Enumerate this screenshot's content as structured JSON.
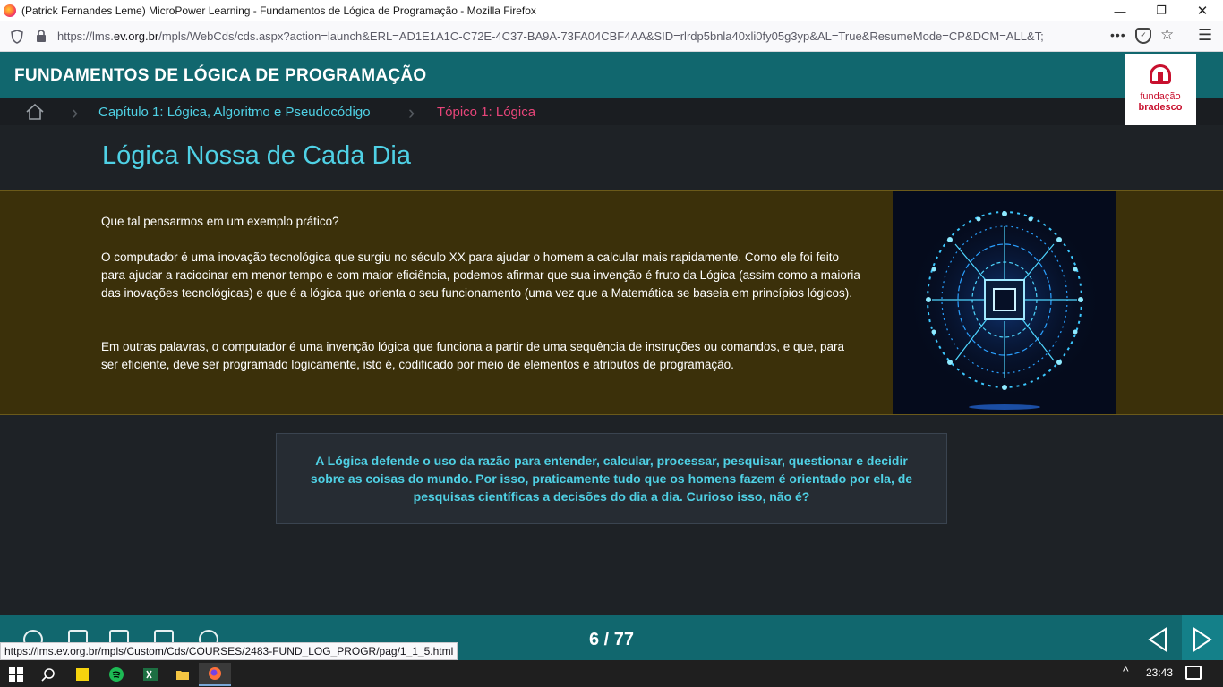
{
  "window": {
    "title": "(Patrick Fernandes Leme) MicroPower Learning - Fundamentos de Lógica de Programação - Mozilla Firefox",
    "minimize": "—",
    "restore": "❐",
    "close": "✕"
  },
  "browser": {
    "url_prefix": "https://lms.",
    "url_domain": "ev.org.br",
    "url_rest": "/mpls/WebCds/cds.aspx?action=launch&ERL=AD1E1A1C-C72E-4C37-BA9A-73FA04CBF4AA&SID=rlrdp5bnla40xli0fy05g3yp&AL=True&ResumeMode=CP&DCM=ALL&T;",
    "more_label": "•••",
    "star_glyph": "☆",
    "menu_glyph": "☰"
  },
  "course": {
    "title": "FUNDAMENTOS DE LÓGICA DE PROGRAMAÇÃO",
    "brand_line1": "fundação",
    "brand_line2": "bradesco"
  },
  "breadcrumb": {
    "chapter": "Capítulo 1: Lógica, Algoritmo e Pseudocódigo",
    "topic": "Tópico 1: Lógica"
  },
  "page": {
    "heading": "Lógica Nossa de Cada Dia",
    "paragraphs": [
      "Que tal pensarmos em um exemplo prático?",
      "O computador é uma inovação tecnológica que surgiu no século XX para ajudar o homem a calcular mais rapidamente. Como ele foi feito para ajudar a raciocinar em menor tempo e com maior eficiência, podemos afirmar que sua invenção é fruto da Lógica (assim como a maioria das inovações tecnológicas) e que é a lógica que orienta o seu funcionamento (uma vez que a Matemática se baseia em princípios lógicos).",
      "Em outras palavras, o computador é uma invenção lógica que funciona a partir de uma sequência de instruções ou comandos, e que, para ser eficiente, deve ser programado logicamente, isto é, codificado por meio de elementos e atributos de programação."
    ],
    "callout": "A Lógica defende o uso da razão para entender, calcular, processar, pesquisar, questionar e decidir sobre as coisas do mundo. Por isso, praticamente tudo que os homens fazem é orientado por ela, de pesquisas científicas a decisões do dia a dia. Curioso isso, não é?"
  },
  "navigation": {
    "page_indicator": "6 / 77"
  },
  "status": {
    "hover_link": "https://lms.ev.org.br/mpls/Custom/Cds/COURSES/2483-FUND_LOG_PROGR/pag/1_1_5.html"
  },
  "taskbar": {
    "time": "23:43",
    "tray_chevron": "^"
  },
  "colors": {
    "accent": "#4fd1e5",
    "topic": "#e8457a",
    "header": "#11676e",
    "band": "#3b300a"
  }
}
